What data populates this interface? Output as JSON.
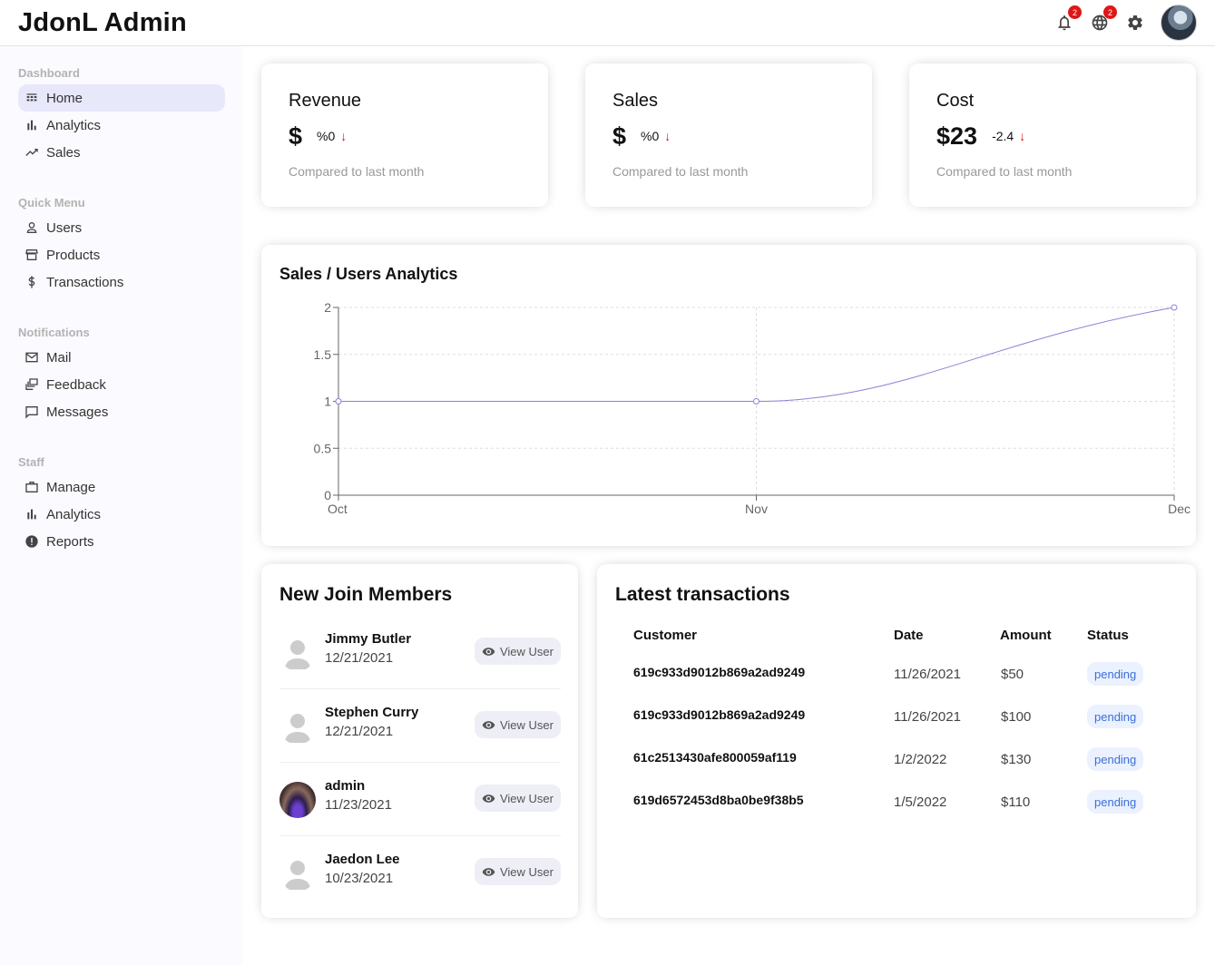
{
  "app": {
    "title": "JdonL Admin"
  },
  "topbar": {
    "notifications_badge": "2",
    "language_badge": "2",
    "icons": [
      "bell-icon",
      "globe-icon",
      "gear-icon",
      "avatar"
    ]
  },
  "sidebar": {
    "sections": [
      {
        "title": "Dashboard",
        "items": [
          {
            "label": "Home",
            "icon": "home-icon",
            "active": true
          },
          {
            "label": "Analytics",
            "icon": "bar-chart-icon"
          },
          {
            "label": "Sales",
            "icon": "trending-up-icon"
          }
        ]
      },
      {
        "title": "Quick Menu",
        "items": [
          {
            "label": "Users",
            "icon": "user-icon"
          },
          {
            "label": "Products",
            "icon": "storefront-icon"
          },
          {
            "label": "Transactions",
            "icon": "dollar-icon"
          }
        ]
      },
      {
        "title": "Notifications",
        "items": [
          {
            "label": "Mail",
            "icon": "mail-icon"
          },
          {
            "label": "Feedback",
            "icon": "dynamic-feed-icon"
          },
          {
            "label": "Messages",
            "icon": "chat-bubble-icon"
          }
        ]
      },
      {
        "title": "Staff",
        "items": [
          {
            "label": "Manage",
            "icon": "briefcase-icon"
          },
          {
            "label": "Analytics",
            "icon": "bar-chart-icon"
          },
          {
            "label": "Reports",
            "icon": "report-icon"
          }
        ]
      }
    ]
  },
  "features": [
    {
      "title": "Revenue",
      "money": "$",
      "rate": "%0",
      "sub": "Compared to last month"
    },
    {
      "title": "Sales",
      "money": "$",
      "rate": "%0",
      "sub": "Compared to last month"
    },
    {
      "title": "Cost",
      "money": "$23",
      "rate": "-2.4",
      "sub": "Compared to last month"
    }
  ],
  "chart": {
    "title": "Sales / Users Analytics"
  },
  "chart_data": {
    "type": "line",
    "title": "Sales / Users Analytics",
    "categories": [
      "Oct",
      "Nov",
      "Dec"
    ],
    "series": [
      {
        "values": [
          1,
          1,
          2
        ]
      }
    ],
    "yticks": [
      "0",
      "0.5",
      "1",
      "1.5",
      "2"
    ],
    "ylim": [
      0,
      2
    ],
    "grid": true,
    "line_color": "#8884d8"
  },
  "members": {
    "title": "New Join Members",
    "button_label": "View User",
    "items": [
      {
        "name": "Jimmy Butler",
        "date": "12/21/2021",
        "avatar": "default"
      },
      {
        "name": "Stephen Curry",
        "date": "12/21/2021",
        "avatar": "default"
      },
      {
        "name": "admin",
        "date": "11/23/2021",
        "avatar": "photo"
      },
      {
        "name": "Jaedon Lee",
        "date": "10/23/2021",
        "avatar": "default"
      }
    ]
  },
  "transactions": {
    "title": "Latest transactions",
    "headers": {
      "customer": "Customer",
      "date": "Date",
      "amount": "Amount",
      "status": "Status"
    },
    "rows": [
      {
        "customer": "619c933d9012b869a2ad9249",
        "date": "11/26/2021",
        "amount": "$50",
        "status": "pending"
      },
      {
        "customer": "619c933d9012b869a2ad9249",
        "date": "11/26/2021",
        "amount": "$100",
        "status": "pending"
      },
      {
        "customer": "61c2513430afe800059af119",
        "date": "1/2/2022",
        "amount": "$130",
        "status": "pending"
      },
      {
        "customer": "619d6572453d8ba0be9f38b5",
        "date": "1/5/2022",
        "amount": "$110",
        "status": "pending"
      }
    ]
  },
  "colors": {
    "accent": "#8884d8",
    "active_bg": "#e8e8fb",
    "down_arrow": "#e01616",
    "status_text": "#3b6fd8",
    "status_bg": "#ebf1fe"
  }
}
